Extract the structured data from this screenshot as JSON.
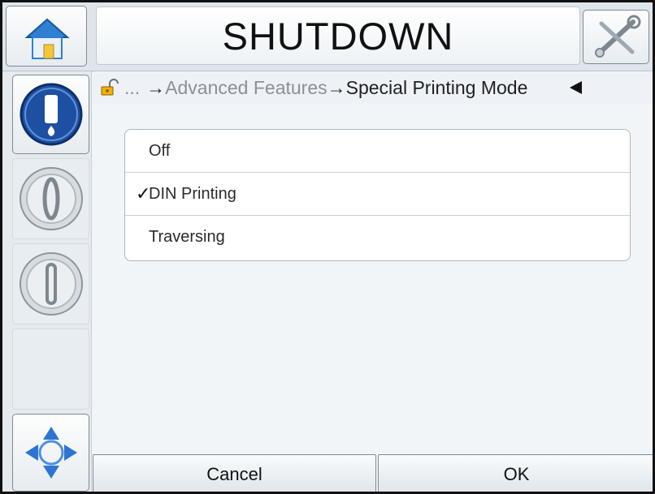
{
  "header": {
    "title": "SHUTDOWN",
    "home_icon": "home-icon",
    "tools_icon": "tools-icon"
  },
  "breadcrumb": {
    "lock_icon": "unlock-icon",
    "ellipsis": "...",
    "arrow": "→",
    "parent": "Advanced Features",
    "current": "Special Printing Mode",
    "back_icon": "back-arrow-icon"
  },
  "options": [
    {
      "label": "Off",
      "selected": false
    },
    {
      "label": "DIN Printing",
      "selected": true
    },
    {
      "label": "Traversing",
      "selected": false
    }
  ],
  "sidebar": {
    "ink_icon": "ink-status-icon",
    "start_icon": "power-on-icon",
    "stop_icon": "power-off-icon",
    "navigation_icon": "navigation-icon"
  },
  "footer": {
    "cancel_label": "Cancel",
    "ok_label": "OK"
  },
  "colors": {
    "accent_blue": "#1f63b7",
    "frame": "#111111"
  }
}
